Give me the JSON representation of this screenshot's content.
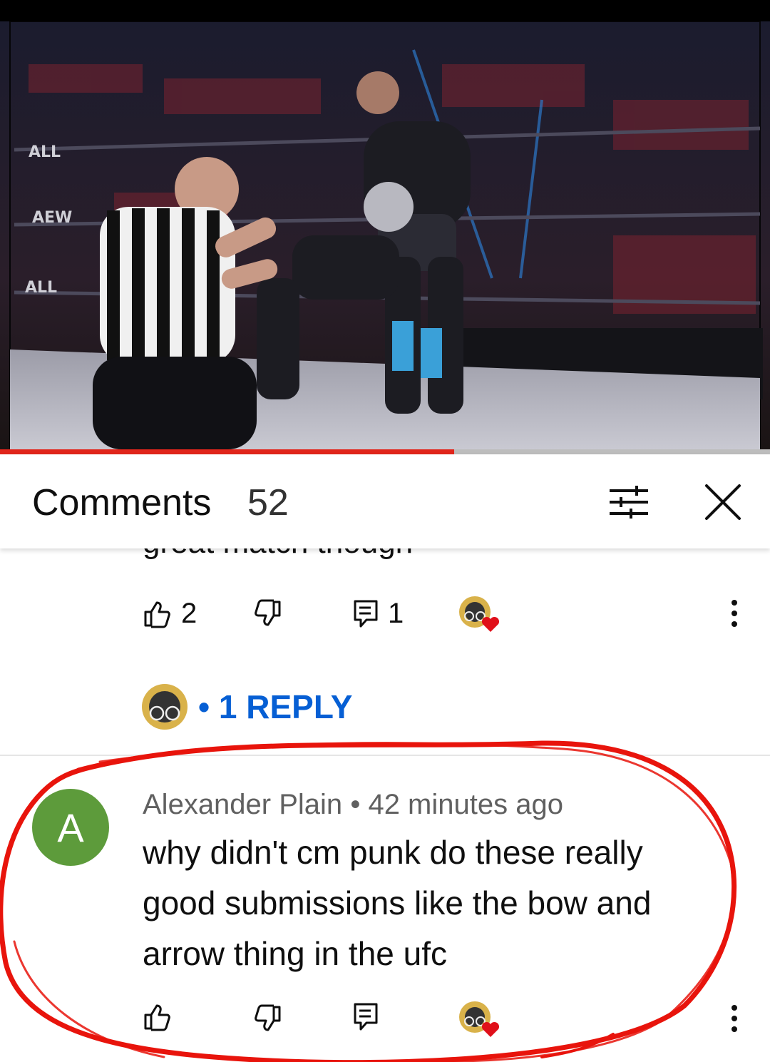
{
  "comments_panel": {
    "title": "Comments",
    "count": "52"
  },
  "previous_comment": {
    "cut_text": "great match though",
    "like_count": "2",
    "reply_count": "1",
    "replies_link": "• 1 REPLY"
  },
  "comment": {
    "avatar_letter": "A",
    "author": "Alexander Plain",
    "separator": "•",
    "time": "42 minutes ago",
    "text": "why didn't cm punk do these really good submissions like the bow and arrow thing in the ufc"
  },
  "video": {
    "progress_fraction": 0.59
  },
  "colors": {
    "accent_red": "#e1251b",
    "link_blue": "#065fd4",
    "avatar_green": "#5d9b3b",
    "annotation_red": "#e8140c"
  },
  "icons": [
    "thumb-up-icon",
    "thumb-down-icon",
    "reply-icon",
    "creator-heart-icon",
    "more-vert-icon",
    "filter-icon",
    "close-icon"
  ]
}
